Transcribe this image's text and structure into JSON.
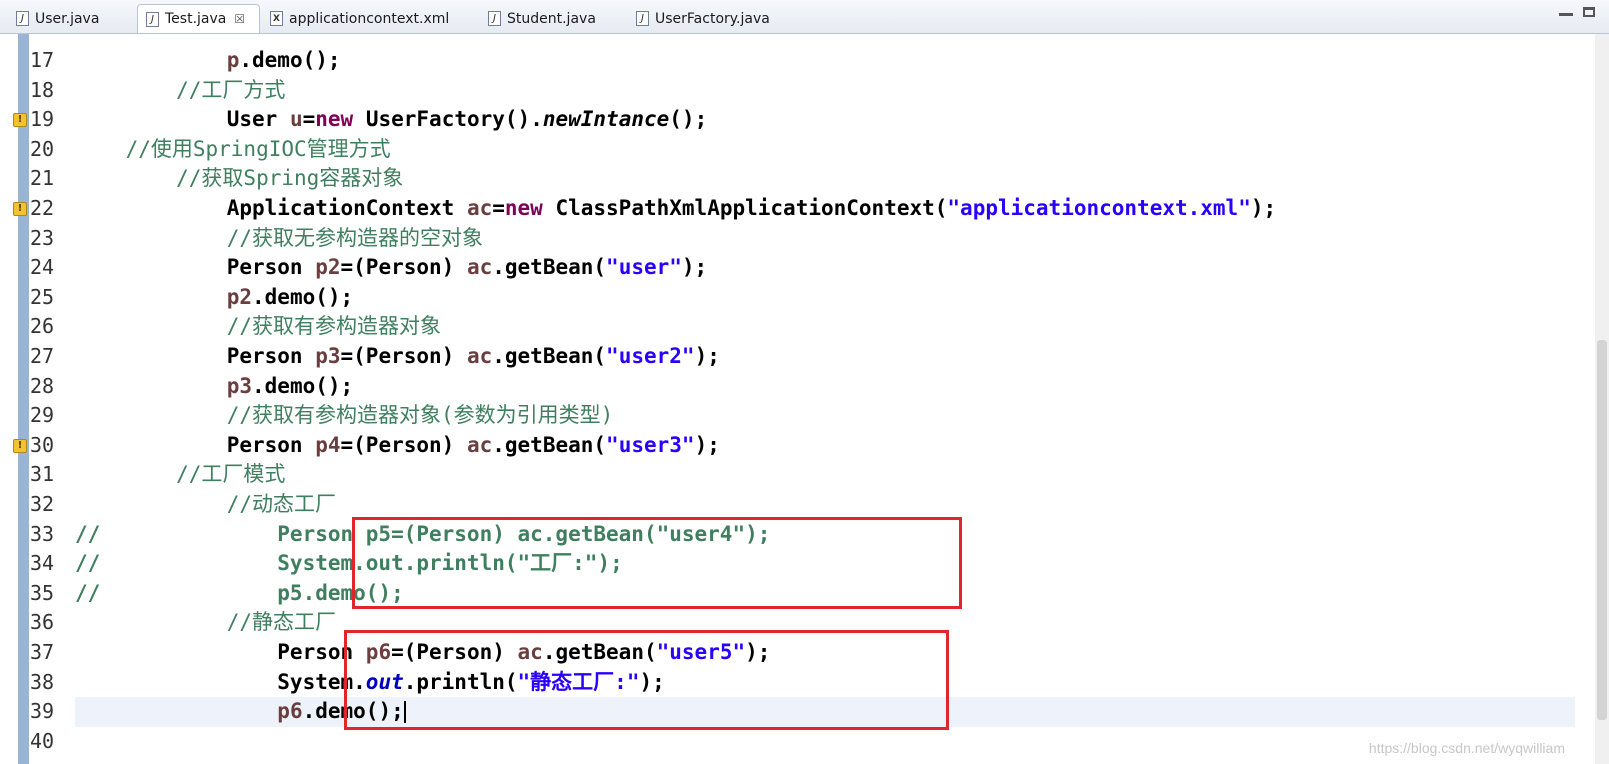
{
  "tabs": [
    {
      "label": "User.java",
      "icon": "java-file-icon",
      "active": false
    },
    {
      "label": "Test.java",
      "icon": "java-file-icon",
      "active": true
    },
    {
      "label": "applicationcontext.xml",
      "icon": "xml-file-icon",
      "active": false
    },
    {
      "label": "Student.java",
      "icon": "java-file-icon",
      "active": false
    },
    {
      "label": "UserFactory.java",
      "icon": "java-file-icon",
      "active": false
    }
  ],
  "tab_close_glyph": "☒",
  "colors": {
    "keyword": "#7f0055",
    "string": "#2a00ff",
    "comment": "#3f7f5f",
    "highlight_box": "#e0252b"
  },
  "lines": [
    {
      "n": "17",
      "segments": [
        [
          "plain",
          "            "
        ],
        [
          "var",
          "p"
        ],
        [
          "plain",
          ".demo();"
        ]
      ]
    },
    {
      "n": "18",
      "segments": [
        [
          "cmt",
          "        //工厂方式"
        ]
      ]
    },
    {
      "n": "19",
      "warn": true,
      "segments": [
        [
          "plain",
          "            User "
        ],
        [
          "var",
          "u"
        ],
        [
          "plain",
          "="
        ],
        [
          "kw",
          "new"
        ],
        [
          "plain",
          " UserFactory()."
        ],
        [
          "ital",
          "newIntance"
        ],
        [
          "plain",
          "();"
        ]
      ]
    },
    {
      "n": "20",
      "segments": [
        [
          "cmt",
          "    //使用SpringIOC管理方式"
        ]
      ]
    },
    {
      "n": "21",
      "segments": [
        [
          "cmt",
          "        //获取Spring容器对象"
        ]
      ]
    },
    {
      "n": "22",
      "warn": true,
      "segments": [
        [
          "plain",
          "            ApplicationContext "
        ],
        [
          "var",
          "ac"
        ],
        [
          "plain",
          "="
        ],
        [
          "kw",
          "new"
        ],
        [
          "plain",
          " ClassPathXmlApplicationContext("
        ],
        [
          "str",
          "\"applicationcontext.xml\""
        ],
        [
          "plain",
          ");"
        ]
      ]
    },
    {
      "n": "23",
      "segments": [
        [
          "cmt",
          "            //获取无参构造器的空对象"
        ]
      ]
    },
    {
      "n": "24",
      "segments": [
        [
          "plain",
          "            Person "
        ],
        [
          "var",
          "p2"
        ],
        [
          "plain",
          "=(Person) "
        ],
        [
          "var",
          "ac"
        ],
        [
          "plain",
          ".getBean("
        ],
        [
          "str",
          "\"user\""
        ],
        [
          "plain",
          ");"
        ]
      ]
    },
    {
      "n": "25",
      "segments": [
        [
          "plain",
          "            "
        ],
        [
          "var",
          "p2"
        ],
        [
          "plain",
          ".demo();"
        ]
      ]
    },
    {
      "n": "26",
      "segments": [
        [
          "cmt",
          "            //获取有参构造器对象"
        ]
      ]
    },
    {
      "n": "27",
      "segments": [
        [
          "plain",
          "            Person "
        ],
        [
          "var",
          "p3"
        ],
        [
          "plain",
          "=(Person) "
        ],
        [
          "var",
          "ac"
        ],
        [
          "plain",
          ".getBean("
        ],
        [
          "str",
          "\"user2\""
        ],
        [
          "plain",
          ");"
        ]
      ]
    },
    {
      "n": "28",
      "segments": [
        [
          "plain",
          "            "
        ],
        [
          "var",
          "p3"
        ],
        [
          "plain",
          ".demo();"
        ]
      ]
    },
    {
      "n": "29",
      "segments": [
        [
          "cmt",
          "            //获取有参构造器对象(参数为引用类型)"
        ]
      ]
    },
    {
      "n": "30",
      "warn": true,
      "segments": [
        [
          "plain",
          "            Person "
        ],
        [
          "var",
          "p4"
        ],
        [
          "plain",
          "=(Person) "
        ],
        [
          "var",
          "ac"
        ],
        [
          "plain",
          ".getBean("
        ],
        [
          "str",
          "\"user3\""
        ],
        [
          "plain",
          ");"
        ]
      ]
    },
    {
      "n": "31",
      "segments": [
        [
          "cmt",
          "        //工厂模式"
        ]
      ]
    },
    {
      "n": "32",
      "segments": [
        [
          "cmt",
          "            //动态工厂"
        ]
      ]
    },
    {
      "n": "33",
      "segments": [
        [
          "cmtcode",
          "//              Person p5=(Person) ac.getBean(\"user4\");"
        ]
      ]
    },
    {
      "n": "34",
      "segments": [
        [
          "cmtcode",
          "//              System.out.println(\"工厂:\");"
        ]
      ]
    },
    {
      "n": "35",
      "segments": [
        [
          "cmtcode",
          "//              p5.demo();"
        ]
      ]
    },
    {
      "n": "36",
      "segments": [
        [
          "cmt",
          "            //静态工厂"
        ]
      ]
    },
    {
      "n": "37",
      "segments": [
        [
          "plain",
          "                Person "
        ],
        [
          "var",
          "p6"
        ],
        [
          "plain",
          "=(Person) "
        ],
        [
          "var",
          "ac"
        ],
        [
          "plain",
          ".getBean("
        ],
        [
          "str",
          "\"user5\""
        ],
        [
          "plain",
          ");"
        ]
      ]
    },
    {
      "n": "38",
      "segments": [
        [
          "plain",
          "                System."
        ],
        [
          "field",
          "out"
        ],
        [
          "plain",
          ".println("
        ],
        [
          "str",
          "\"静态工厂:\""
        ],
        [
          "plain",
          ");"
        ]
      ]
    },
    {
      "n": "39",
      "current": true,
      "caret": true,
      "segments": [
        [
          "plain",
          "                "
        ],
        [
          "var",
          "p6"
        ],
        [
          "plain",
          ".demo();"
        ]
      ]
    },
    {
      "n": "40",
      "segments": []
    }
  ],
  "watermark": "https://blog.csdn.net/wyqwilliam"
}
